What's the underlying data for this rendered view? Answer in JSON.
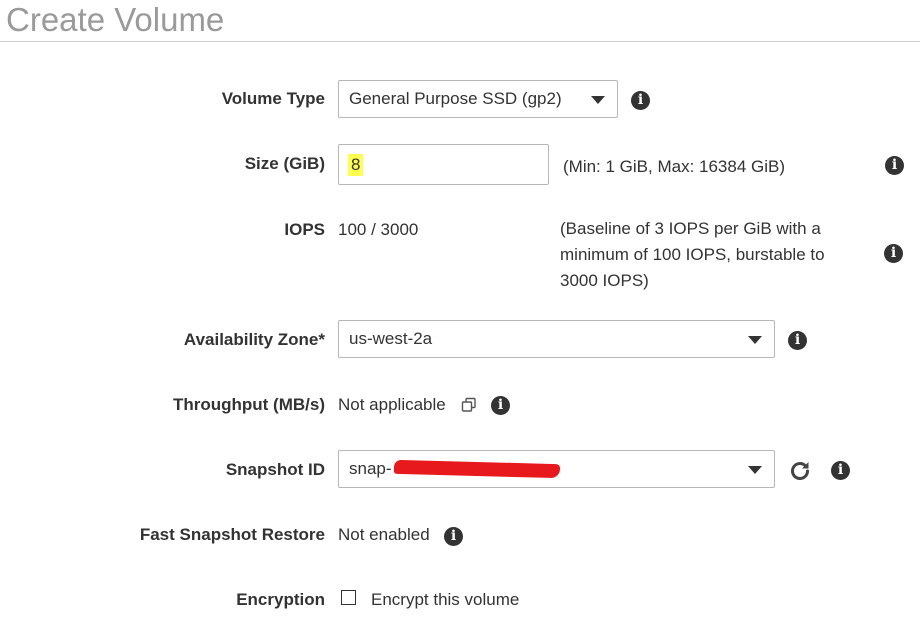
{
  "title": "Create Volume",
  "volume_type": {
    "label": "Volume Type",
    "selected": "General Purpose SSD (gp2)",
    "info_icon": "info-icon"
  },
  "size": {
    "label": "Size (GiB)",
    "value": "8",
    "hint": "(Min: 1 GiB, Max: 16384 GiB)"
  },
  "iops": {
    "label": "IOPS",
    "value": "100 / 3000",
    "hint_lines": [
      "(Baseline of 3 IOPS per GiB with a",
      "minimum of 100 IOPS, burstable to",
      "3000 IOPS)"
    ]
  },
  "availability_zone": {
    "label": "Availability Zone*",
    "selected": "us-west-2a"
  },
  "throughput": {
    "label": "Throughput (MB/s)",
    "value": "Not applicable"
  },
  "snapshot": {
    "label": "Snapshot ID",
    "selected": "snap-"
  },
  "fast_snapshot": {
    "label": "Fast Snapshot Restore",
    "value": "Not enabled"
  },
  "encryption": {
    "label": "Encryption",
    "checkbox_label": "Encrypt this volume",
    "checked": false
  },
  "icons": [
    "info-icon",
    "copy-icon",
    "refresh-icon",
    "chevron-down-icon"
  ],
  "colors": {
    "highlight": "#ffff50",
    "redaction": "#e8191c",
    "title": "#9a9a9a"
  }
}
